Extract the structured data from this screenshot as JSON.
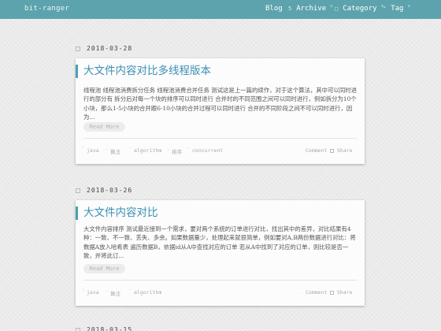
{
  "nav": {
    "brand": "bit-ranger",
    "items": [
      {
        "label": "Blog",
        "icon": "",
        "has_chevron": false
      },
      {
        "label": "Archive",
        "icon": "5",
        "has_chevron": true
      },
      {
        "label": "Category",
        "icon": "□",
        "has_chevron": true
      },
      {
        "label": "Tag",
        "icon": "\"",
        "has_chevron": true
      }
    ]
  },
  "posts": [
    {
      "date": "2018-03-28",
      "title": "大文件内容对比多线程版本",
      "excerpt": "线程池 线程池消费拆分任务 线程池消费合并任务 测试这是上一篇的续作，对于这个算法，其中可以同时进行的部分有 拆分后对每一个块的排序可以同时进行 合并时的不同范围之间可以同时进行，例如拆分为10个小块，那么1-5小块的合并跟6-10小块的合并过程可以同时进行 合并的不同阶段之间不可以同时进行，因为...",
      "read_more": "Read More",
      "tags": [
        "java",
        "算法",
        "algorithm",
        "排序",
        "concurrent"
      ],
      "comment_label": "Comment",
      "share_label": "Share"
    },
    {
      "date": "2018-03-26",
      "title": "大文件内容对比",
      "excerpt": "大文件内容排序 测试最近接到一个需求，要对两个系统的订单进行对比，找出其中的差异，对比结果有4种：一致、不一致、丢失、多余。如果数据量少，处理起来就很简单，例如要对A,B两份数据进行对比：将数据A放入哈希表 遍历数据B，依据id从A中查找对应的订单 若从A中找到了对应的订单，则比较是否一致，并将此订...",
      "read_more": "Read More",
      "tags": [
        "java",
        "算法",
        "algorithm"
      ],
      "comment_label": "Comment",
      "share_label": "Share"
    },
    {
      "date": "2018-03-15"
    }
  ],
  "colors": {
    "nav_bg": "#5da3ad",
    "title": "#3a8fb4",
    "accent_bar": "#4aa0b5"
  }
}
